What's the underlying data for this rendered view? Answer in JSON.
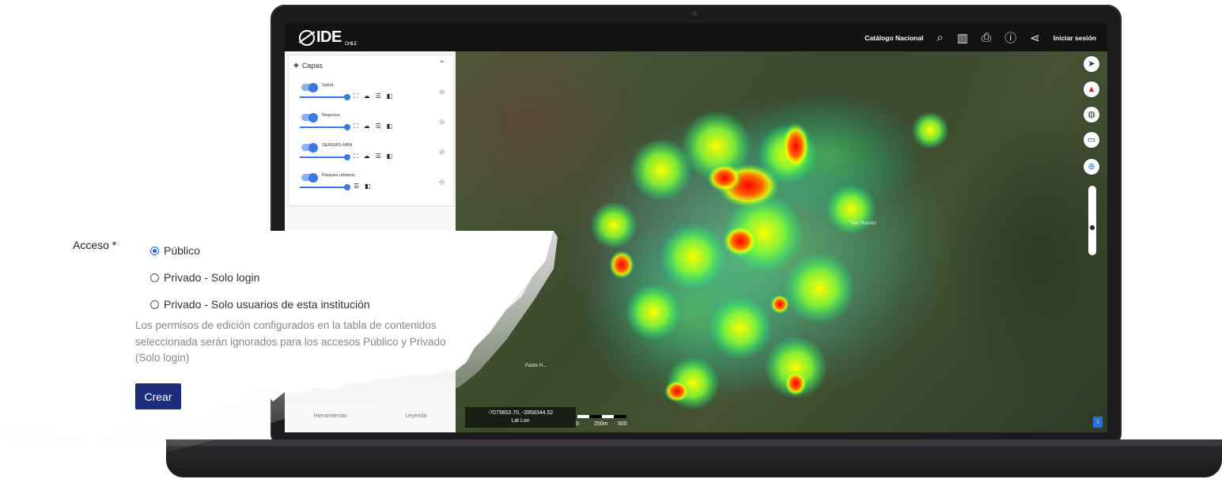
{
  "app": {
    "logo_text": "IDE",
    "logo_sub": "CHILE"
  },
  "topnav": {
    "catalog": "Catálogo Nacional",
    "login": "Iniciar sesión",
    "icons": [
      "search-map-icon",
      "map-icon",
      "print-icon",
      "help-icon",
      "share-icon"
    ]
  },
  "panel": {
    "title": "Capas",
    "layers": [
      {
        "label": "Salud"
      },
      {
        "label": "Negocios"
      },
      {
        "label": "SEREMIS MBN"
      },
      {
        "label": "Parques urbanos"
      }
    ],
    "tabs": [
      "Herramientas",
      "Leyenda"
    ]
  },
  "map": {
    "coordinates": "-7079853.70, -3958344.52",
    "coord_type": "Lat Lon",
    "scale_labels": [
      "0",
      "250m",
      "500"
    ],
    "places": [
      "San Ramón",
      "Padre H..."
    ]
  },
  "form": {
    "label": "Acceso *",
    "options": [
      {
        "label": "Público",
        "selected": true
      },
      {
        "label": "Privado - Solo login",
        "selected": false
      },
      {
        "label": "Privado - Solo usuarios de esta institución",
        "selected": false
      }
    ],
    "help_text": "Los permisos de edición configurados en la tabla de contenidos seleccionada serán ignorados para los accesos Público y Privado (Solo login)",
    "submit_label": "Crear"
  },
  "colors": {
    "accent": "#3a78e6",
    "button": "#1e2d7a",
    "heat_hot": "#ff0000",
    "heat_warm": "#ffff00",
    "heat_cool": "#00ff66"
  }
}
